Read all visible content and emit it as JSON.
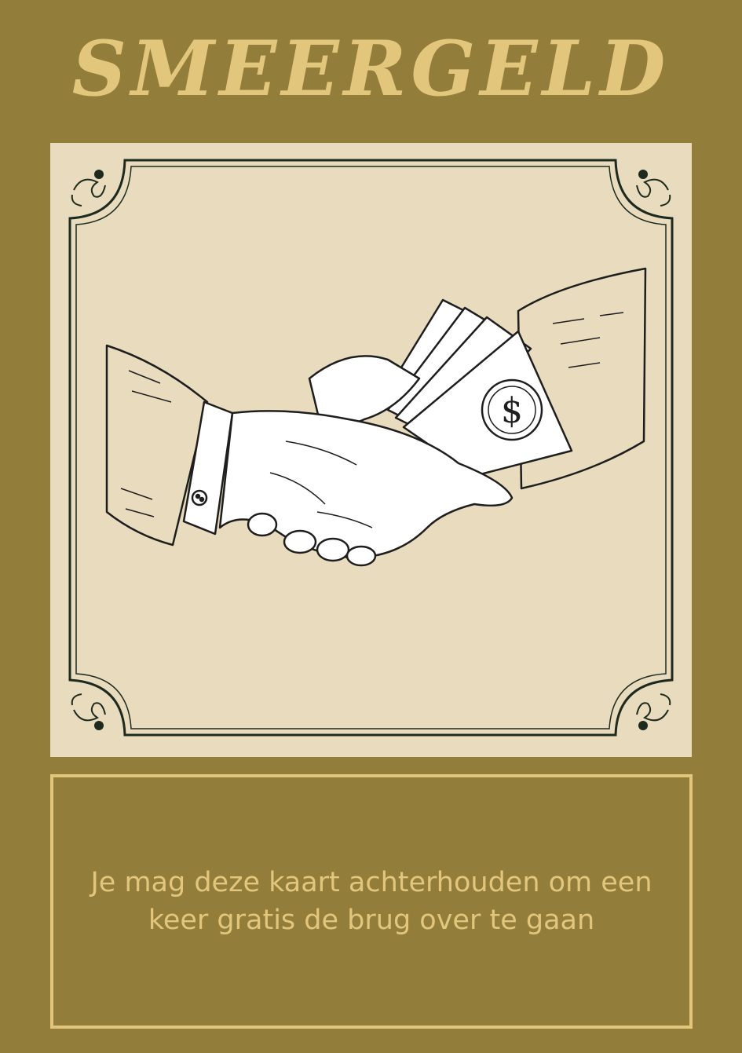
{
  "card": {
    "title": "SMEERGELD",
    "description": "Je mag deze kaart achterhouden om een keer gratis de brug over te gaan"
  },
  "colors": {
    "background": "#937d3b",
    "accent": "#e2c67c",
    "panel": "#e9dcbe",
    "ink": "#1e2a1e"
  },
  "illustration": {
    "icon": "handshake-bribe-icon",
    "money_symbol": "$"
  }
}
